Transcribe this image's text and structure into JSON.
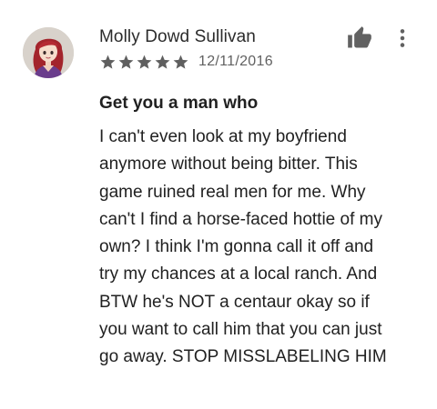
{
  "review": {
    "author": "Molly Dowd Sullivan",
    "rating": 5,
    "rating_max": 5,
    "date": "12/11/2016",
    "title": "Get you a man who",
    "body": "I can't even look at my boyfriend\nanymore without being bitter. This\ngame ruined real men for me. Why\ncan't I find a horse-faced hottie of my\nown? I think I'm gonna call it off and\ntry my chances at a local ranch. And\nBTW he's NOT a centaur okay so if\nyou want to call him that you can just\ngo away. STOP MISSLABELING HIM"
  },
  "icons": {
    "thumb": "thumbs-up-icon",
    "menu": "more-vert-icon",
    "star": "star-icon"
  },
  "colors": {
    "star": "#5f5f5f",
    "icon": "#616161",
    "text": "#212121",
    "secondary_text": "#616161"
  }
}
